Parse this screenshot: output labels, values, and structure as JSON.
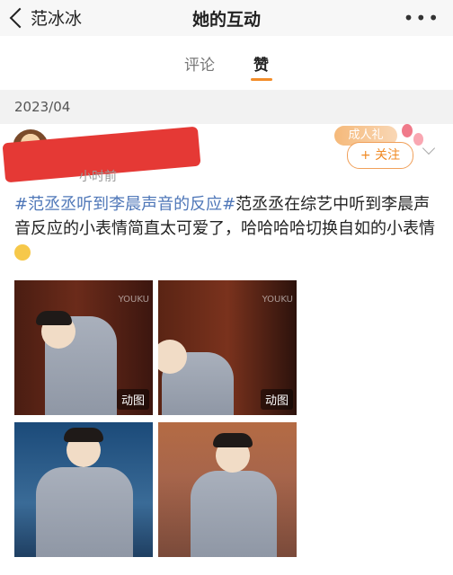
{
  "nav": {
    "back_label": "范冰冰",
    "title": "她的互动",
    "more_label": "•••"
  },
  "tabs": [
    {
      "label": "评论"
    },
    {
      "label": "赞"
    }
  ],
  "date": "2023/04",
  "post": {
    "time": "小时前",
    "badge": "成人礼",
    "follow_label": "+ 关注",
    "hashtag": "#范丞丞听到李晨声音的反应#",
    "text": "范丞丞在综艺中听到李晨声音反应的小表情简直太可爱了，哈哈哈哈切换自如的小表情",
    "images": [
      {
        "gif_label": "动图",
        "watermark": "YOUKU"
      },
      {
        "gif_label": "动图",
        "watermark": "YOUKU"
      },
      {},
      {}
    ]
  },
  "colors": {
    "accent": "#f28c28",
    "tag": "#4f77b8"
  }
}
